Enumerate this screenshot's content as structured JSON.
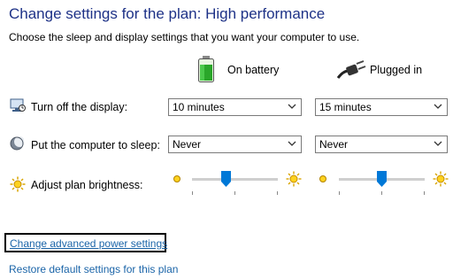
{
  "page": {
    "title": "Change settings for the plan: High performance",
    "subtitle": "Choose the sleep and display settings that you want your computer to use."
  },
  "columns": {
    "battery_label": "On battery",
    "plugged_label": "Plugged in"
  },
  "rows": {
    "display": {
      "label": "Turn off the display:",
      "battery_value": "10 minutes",
      "plugged_value": "15 minutes"
    },
    "sleep": {
      "label": "Put the computer to sleep:",
      "battery_value": "Never",
      "plugged_value": "Never"
    },
    "brightness": {
      "label": "Adjust plan brightness:",
      "battery_level": 0.38,
      "plugged_level": 0.5
    }
  },
  "links": {
    "advanced": "Change advanced power settings",
    "restore": "Restore default settings for this plan"
  },
  "colors": {
    "title": "#1e3287",
    "link": "#1a64a8",
    "slider_thumb": "#0078d7"
  }
}
